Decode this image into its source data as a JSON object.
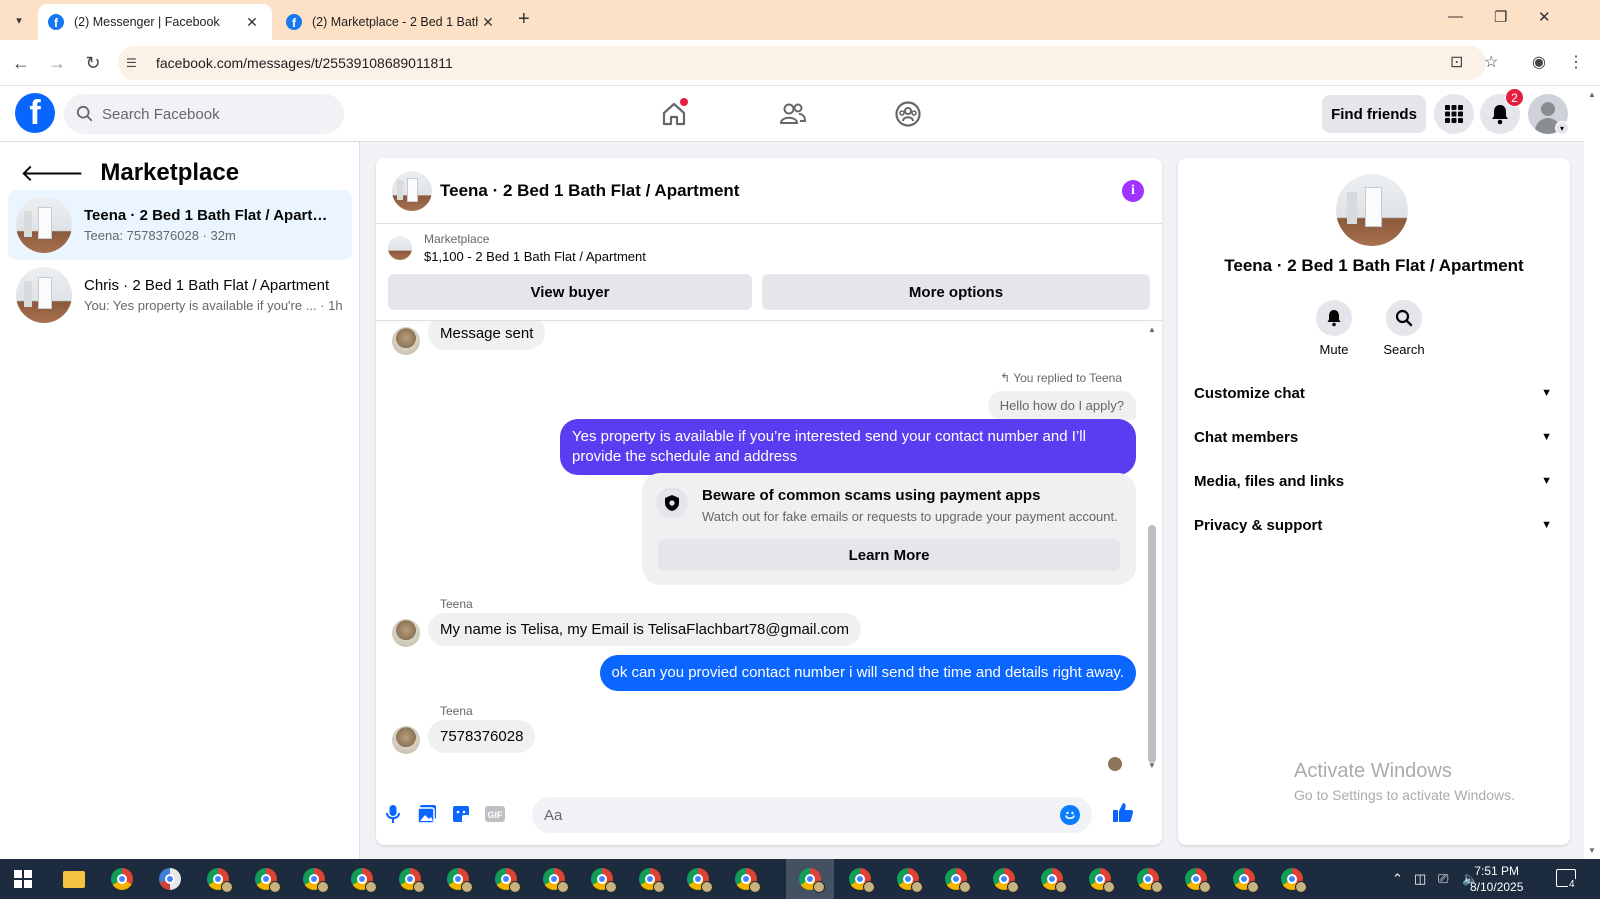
{
  "browser": {
    "tabs": [
      {
        "title": "(2) Messenger | Facebook",
        "active": true
      },
      {
        "title": "(2) Marketplace - 2 Bed 1 Bath F",
        "active": false
      }
    ],
    "url": "facebook.com/messages/t/25539108689011811"
  },
  "fb": {
    "search_placeholder": "Search Facebook",
    "find_friends_label": "Find friends",
    "notification_count": "2"
  },
  "sidebar": {
    "title": "Marketplace",
    "conversations": [
      {
        "name": "Teena · 2 Bed 1 Bath Flat / Apartm...",
        "preview": "Teena: 7578376028 · 32m"
      },
      {
        "name": "Chris · 2 Bed 1 Bath Flat / Apartment",
        "preview": "You: Yes property is available if you're ... · 1h"
      }
    ]
  },
  "chat": {
    "title": "Teena · 2 Bed 1 Bath Flat / Apartment",
    "listing_label": "Marketplace",
    "listing_price": "$1,100 - 2 Bed 1 Bath Flat / Apartment",
    "view_buyer_label": "View buyer",
    "more_options_label": "More options",
    "messages": {
      "message_sent": "Message sent",
      "reply_note": "You replied to Teena",
      "replied_to": "Hello how do I apply?",
      "out_1": "Yes property is  available if you’re interested send your contact number and I’ll provide the schedule and address",
      "scam_title": "Beware of common scams using payment apps",
      "scam_sub": "Watch out for fake emails or requests to upgrade your payment account.",
      "learn_more": "Learn More",
      "sender_1": "Teena",
      "in_1": "My name is Telisa, my Email is TelisaFlachbart78@gmail.com",
      "out_2": "ok can you provied contact number i will send the time and details right away.",
      "sender_2": "Teena",
      "in_2": "7578376028"
    },
    "composer_placeholder": "Aa"
  },
  "right_panel": {
    "name": "Teena · 2 Bed 1 Bath Flat / Apartment",
    "mute_label": "Mute",
    "search_label": "Search",
    "rows": [
      "Customize chat",
      "Chat members",
      "Media, files and links",
      "Privacy & support"
    ],
    "watermark_title": "Activate Windows",
    "watermark_sub": "Go to Settings to activate Windows."
  },
  "taskbar": {
    "time": "7:51 PM",
    "date": "8/10/2025",
    "notification_count": "4"
  },
  "colors": {
    "fb_blue": "#0866ff",
    "outgoing_bubble": "#0a66ff",
    "outgoing_bubble_alt": "#5a3df0",
    "tabstrip": "#fde1c6",
    "taskbar": "#1c2b3d"
  }
}
